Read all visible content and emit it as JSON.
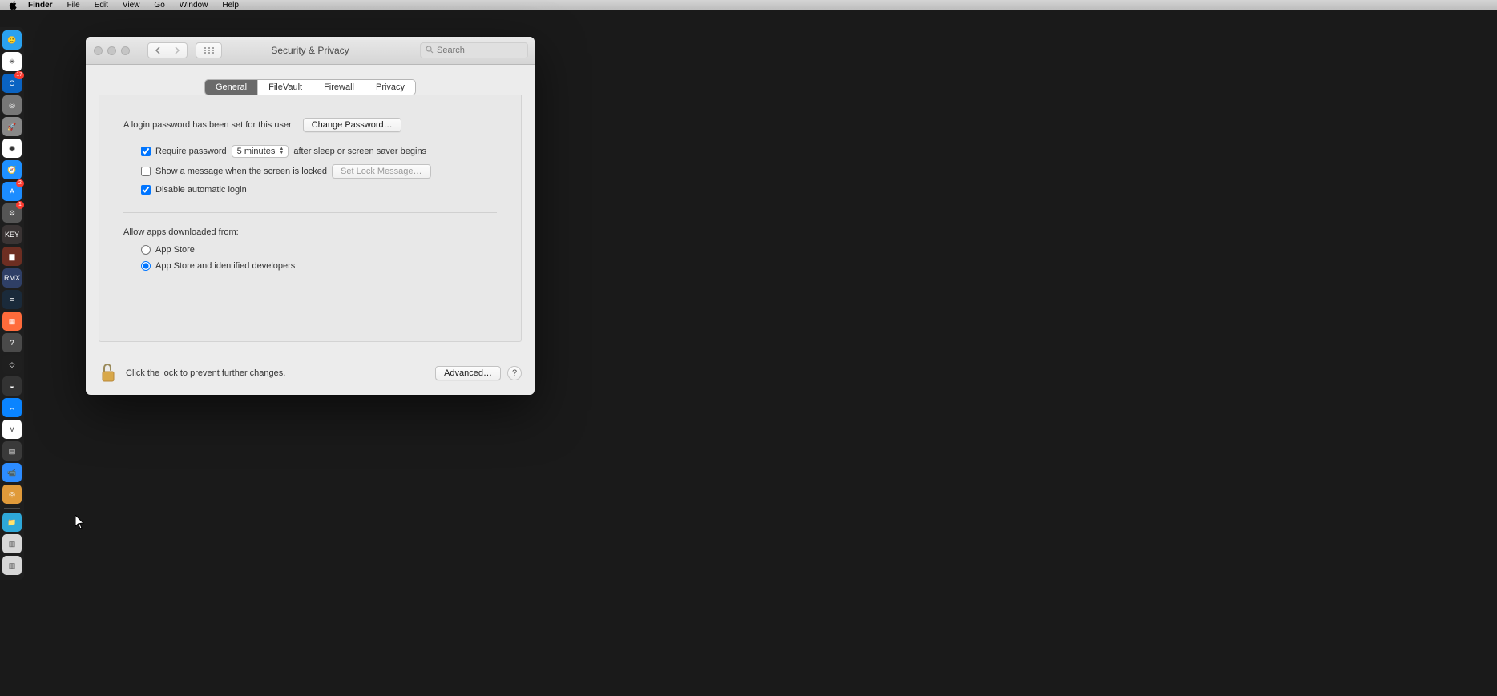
{
  "menubar": {
    "app": "Finder",
    "items": [
      "File",
      "Edit",
      "View",
      "Go",
      "Window",
      "Help"
    ]
  },
  "dock": {
    "icons": [
      {
        "name": "finder",
        "bg": "#2aa1ef",
        "glyph": "🙂"
      },
      {
        "name": "slack",
        "bg": "#ffffff",
        "glyph": "✳︎"
      },
      {
        "name": "outlook",
        "bg": "#0a63c2",
        "glyph": "O",
        "badge": "17"
      },
      {
        "name": "safari-gray",
        "bg": "#777",
        "glyph": "◎"
      },
      {
        "name": "launchpad",
        "bg": "#888",
        "glyph": "🚀"
      },
      {
        "name": "chrome",
        "bg": "#ffffff",
        "glyph": "◉"
      },
      {
        "name": "safari",
        "bg": "#1e90ff",
        "glyph": "🧭"
      },
      {
        "name": "appstore",
        "bg": "#1c8cff",
        "glyph": "A",
        "badge": "2"
      },
      {
        "name": "systempreferences",
        "bg": "#555",
        "glyph": "⚙︎",
        "badge": "1"
      },
      {
        "name": "key",
        "bg": "#3a3434",
        "glyph": "KEY"
      },
      {
        "name": "trilian",
        "bg": "#6d2e22",
        "glyph": "▆"
      },
      {
        "name": "rmx",
        "bg": "#2f3f66",
        "glyph": "RMX"
      },
      {
        "name": "omni",
        "bg": "#1a2a3a",
        "glyph": "≡"
      },
      {
        "name": "figma",
        "bg": "#ff6b3b",
        "glyph": "▦"
      },
      {
        "name": "help",
        "bg": "#4a4a4a",
        "glyph": "?"
      },
      {
        "name": "dropbox",
        "bg": "#1f1f1f",
        "glyph": "◇"
      },
      {
        "name": "protools",
        "bg": "#333",
        "glyph": "◒"
      },
      {
        "name": "teamviewer",
        "bg": "#0a84ff",
        "glyph": "↔"
      },
      {
        "name": "v-app",
        "bg": "#fff",
        "glyph": "V"
      },
      {
        "name": "notes",
        "bg": "#3a3a3a",
        "glyph": "▤"
      },
      {
        "name": "zoom",
        "bg": "#2d8cff",
        "glyph": "📹"
      },
      {
        "name": "preview",
        "bg": "#e09a3a",
        "glyph": "◎"
      }
    ],
    "recents": [
      {
        "name": "folder",
        "bg": "#2ea8d9",
        "glyph": "📁"
      },
      {
        "name": "pages",
        "bg": "#d8d8d8",
        "glyph": "▥"
      },
      {
        "name": "doc",
        "bg": "#d8d8d8",
        "glyph": "▥"
      }
    ]
  },
  "window": {
    "title": "Security & Privacy",
    "search_placeholder": "Search",
    "tabs": [
      "General",
      "FileVault",
      "Firewall",
      "Privacy"
    ],
    "active_tab": 0,
    "general": {
      "login_text": "A login password has been set for this user",
      "change_password": "Change Password…",
      "require_password_label": "Require password",
      "require_password_checked": true,
      "delay_selected": "5 minutes",
      "after_sleep_label": "after sleep or screen saver begins",
      "show_message_label": "Show a message when the screen is locked",
      "show_message_checked": false,
      "set_lock_message": "Set Lock Message…",
      "disable_auto_label": "Disable automatic login",
      "disable_auto_checked": true,
      "allow_apps_label": "Allow apps downloaded from:",
      "radio_options": [
        "App Store",
        "App Store and identified developers"
      ],
      "radio_selected": 1
    },
    "footer": {
      "lock_text": "Click the lock to prevent further changes.",
      "advanced": "Advanced…",
      "help": "?"
    }
  }
}
